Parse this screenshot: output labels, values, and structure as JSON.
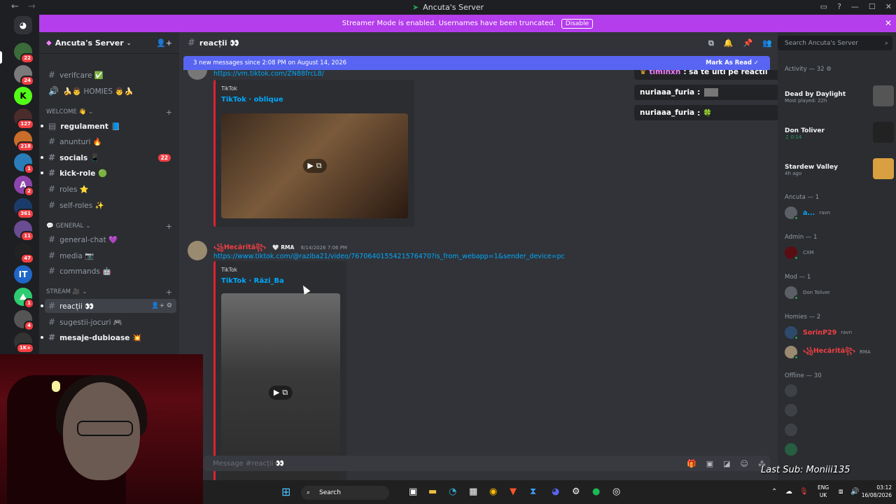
{
  "window": {
    "title": "Ancuta's Server"
  },
  "banner": {
    "text": "Streamer Mode is enabled. Usernames have been truncated.",
    "disable_label": "Disable"
  },
  "server_rail": {
    "badges": [
      "22",
      "24",
      "127",
      "218",
      "1",
      "2",
      "361",
      "11",
      "47",
      "1",
      "4",
      "1K+"
    ]
  },
  "server": {
    "name": "Ancuta's Server"
  },
  "channels": {
    "top": [
      {
        "name": "verifcare ✅"
      },
      {
        "name": "🍌👨 HOMIES 👨🍌"
      }
    ],
    "welcome_cat": "WELCOME 👋",
    "welcome": [
      {
        "name": "regulament 📘"
      },
      {
        "name": "anunturi 🔥"
      },
      {
        "name": "socials 📱",
        "count": "22"
      },
      {
        "name": "kick-role 🟢"
      },
      {
        "name": "roles ⭐"
      },
      {
        "name": "self-roles ✨"
      }
    ],
    "general_cat": "GENERAL",
    "general": [
      {
        "name": "general-chat 💜"
      },
      {
        "name": "media 📷"
      },
      {
        "name": "commands 🤖"
      }
    ],
    "stream_cat": "STREAM 🎥",
    "stream": [
      {
        "name": "reacții 👀"
      },
      {
        "name": "sugestii-jocuri 🎮"
      },
      {
        "name": "mesaje-dubioase 💥"
      }
    ]
  },
  "chat": {
    "channel": "reacții 👀",
    "new_messages": "3 new messages since 2:08 PM on August 14, 2026",
    "mark_read": "Mark As Read",
    "msg1": {
      "link": "https://vm.tiktok.com/ZN88frcL8/",
      "provider": "TikTok",
      "title": "TikTok · oblique"
    },
    "msg2": {
      "author": "꧁Hecărită꧂",
      "role_tag": "RMA",
      "time": "8/14/2026 7:06 PM",
      "link": "https://www.tiktok.com/@raziba21/video/7670640155421576470?is_from_webapp=1&sender_device=pc",
      "provider": "TikTok",
      "title": "TikTok · Răzi_Ba"
    },
    "composer_placeholder": "Message #reacții 👀"
  },
  "popup": [
    {
      "name": "timihxh",
      "text": ": sa te uiti pe reactii"
    },
    {
      "name": "nuriaaa_furia",
      "text": ":"
    },
    {
      "name": "nuriaaa_furia",
      "text": ": 🍀"
    }
  ],
  "members": {
    "search_placeholder": "Search Ancuta's Server",
    "activity_header": "Activity — 32",
    "activities": [
      {
        "title": "Dead by Daylight",
        "sub": "Most played: 22h"
      },
      {
        "title": "Don Toliver",
        "sub": "0:14"
      },
      {
        "title": "Stardew Valley",
        "sub": "4h ago"
      }
    ],
    "groups": [
      {
        "label": "Ancuta — 1",
        "members": [
          {
            "name": "a...",
            "sub": "ravn"
          }
        ]
      },
      {
        "label": "Admin — 1",
        "members": [
          {
            "name": "",
            "sub": "CXM"
          }
        ]
      },
      {
        "label": "Mod — 1",
        "members": [
          {
            "name": "",
            "sub": "Don Toliver"
          }
        ]
      },
      {
        "label": "Homies — 2",
        "members": [
          {
            "name": "SorinP29",
            "sub": "ravn"
          },
          {
            "name": "꧁Hecărită꧂",
            "sub": "RMA"
          }
        ]
      },
      {
        "label": "Offline — 30",
        "members": []
      }
    ]
  },
  "stream_overlay": {
    "last_sub": "Last Sub: Moniii135"
  },
  "taskbar": {
    "search": "Search",
    "lang": "ENG",
    "region": "UK",
    "time": "03:12",
    "date": "16/08/2026"
  },
  "colors": {
    "accent": "#5865f2",
    "banner": "#b43dec",
    "danger": "#f23f43",
    "link": "#00a8fc"
  }
}
